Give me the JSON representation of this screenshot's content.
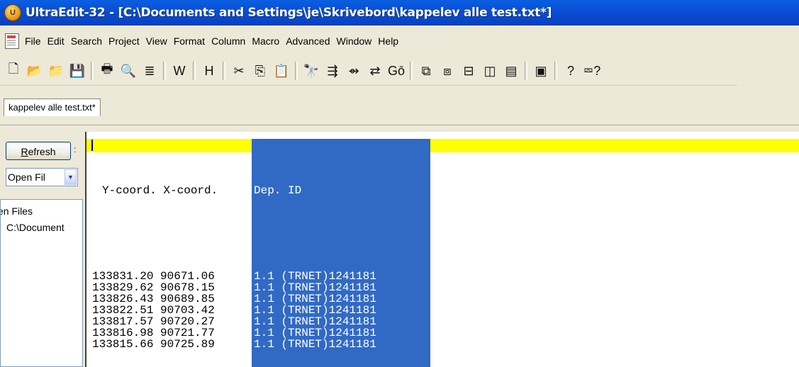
{
  "window": {
    "title": "UltraEdit-32 - [C:\\Documents and Settings\\je\\Skrivebord\\kappelev alle test.txt*]",
    "app_icon_letter": "U"
  },
  "menu": [
    "File",
    "Edit",
    "Search",
    "Project",
    "View",
    "Format",
    "Column",
    "Macro",
    "Advanced",
    "Window",
    "Help"
  ],
  "toolbar": {
    "buttons": [
      {
        "name": "new-file-icon",
        "glyph": "🗋"
      },
      {
        "name": "open-file-icon",
        "glyph": "📂"
      },
      {
        "name": "open-folder-icon",
        "glyph": "📁"
      },
      {
        "name": "save-icon",
        "glyph": "💾"
      },
      {
        "sep": true
      },
      {
        "name": "print-icon",
        "glyph": "🖶"
      },
      {
        "name": "print-preview-icon",
        "glyph": "🔍"
      },
      {
        "name": "hex-mode-icon",
        "glyph": "≣"
      },
      {
        "sep": true
      },
      {
        "name": "word-wrap-icon",
        "glyph": "W"
      },
      {
        "sep": true
      },
      {
        "name": "hex-edit-icon",
        "glyph": "H"
      },
      {
        "sep": true
      },
      {
        "name": "cut-icon",
        "glyph": "✂"
      },
      {
        "name": "copy-icon",
        "glyph": "⎘"
      },
      {
        "name": "paste-icon",
        "glyph": "📋"
      },
      {
        "sep": true
      },
      {
        "name": "find-icon",
        "glyph": "🔭"
      },
      {
        "name": "find-next-icon",
        "glyph": "⇶"
      },
      {
        "name": "find-prev-icon",
        "glyph": "⇴"
      },
      {
        "name": "replace-icon",
        "glyph": "⇄"
      },
      {
        "name": "goto-icon",
        "glyph": "Gō"
      },
      {
        "sep": true
      },
      {
        "name": "tile-icon",
        "glyph": "⧉"
      },
      {
        "name": "cascade-icon",
        "glyph": "⧈"
      },
      {
        "name": "split-horizontal-icon",
        "glyph": "⊟"
      },
      {
        "name": "split-vertical-icon",
        "glyph": "◫"
      },
      {
        "name": "window-list-icon",
        "glyph": "▤"
      },
      {
        "sep": true
      },
      {
        "name": "tool-icon",
        "glyph": "▣"
      },
      {
        "sep": true
      },
      {
        "name": "help-icon",
        "glyph": "?"
      },
      {
        "name": "context-help-icon",
        "glyph": "⮹?"
      }
    ]
  },
  "tabs": [
    {
      "label": "kappelev alle test.txt*"
    }
  ],
  "sidebar": {
    "refresh_label": "efresh",
    "refresh_underline": "R",
    "colon": ":",
    "dropdown_value": "Open Fil",
    "tree": [
      "en Files",
      "C:\\Document"
    ]
  },
  "editor": {
    "header_left": "Y-coord. X-coord.",
    "header_sel": "Dep. ID",
    "rows": [
      {
        "y": "133831.20",
        "x": "90671.06",
        "dep": "1.1",
        "id": "(TRNET)1241181"
      },
      {
        "y": "133829.62",
        "x": "90678.15",
        "dep": "1.1",
        "id": "(TRNET)1241181"
      },
      {
        "y": "133826.43",
        "x": "90689.85",
        "dep": "1.1",
        "id": "(TRNET)1241181"
      },
      {
        "y": "133822.51",
        "x": "90703.42",
        "dep": "1.1",
        "id": "(TRNET)1241181"
      },
      {
        "y": "133817.57",
        "x": "90720.27",
        "dep": "1.1",
        "id": "(TRNET)1241181"
      },
      {
        "y": "133816.98",
        "x": "90721.77",
        "dep": "1.1",
        "id": "(TRNET)1241181"
      },
      {
        "y": "133815.66",
        "x": "90725.89",
        "dep": "1.1",
        "id": "(TRNET)1241181"
      }
    ],
    "highlight_color": "#ffff00",
    "selection_color": "#316ac5"
  }
}
